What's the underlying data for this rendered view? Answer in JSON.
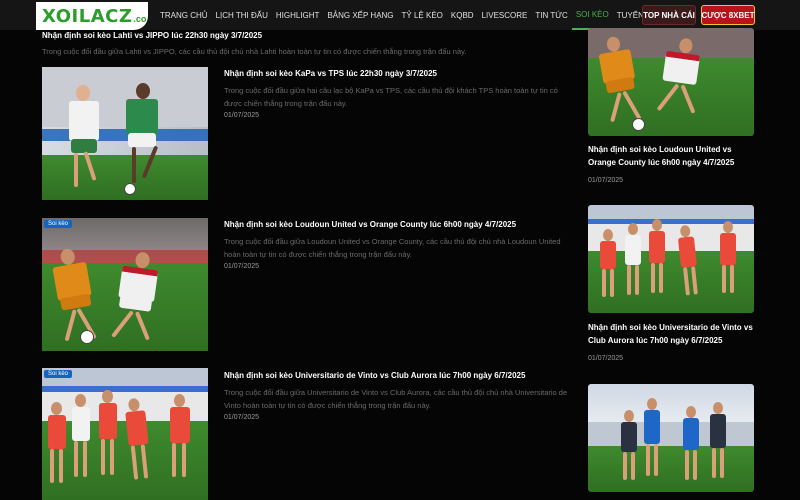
{
  "header": {
    "logo_text": "XOILACZ",
    "logo_suffix": ".co",
    "nav": [
      "TRANG CHỦ",
      "LỊCH THI ĐẤU",
      "HIGHLIGHT",
      "BẢNG XẾP HẠNG",
      "TỶ LỆ KÈO",
      "KQBD",
      "LIVESCORE",
      "TIN TỨC",
      "SOI KÈO",
      "TUYỂN DỤNG"
    ],
    "active_nav": "SOI KÈO",
    "btn_top": "TOP NHÀ CÁI",
    "btn_bet": "CƯỢC 8XBET"
  },
  "feed": {
    "top_title": "Nhận định soi kèo Lahti vs JIPPO lúc 22h30 ngày 3/7/2025",
    "top_desc": "Trong cuộc đối đầu giữa Lahti vs JIPPO, các cầu thủ đội chủ nhà Lahti hoàn toàn tự tin có được chiến thắng trong trận đấu này.",
    "badge": "Soi kèo",
    "articles": [
      {
        "title": "Nhận định soi kèo KaPa vs TPS lúc 22h30 ngày 3/7/2025",
        "desc": "Trong cuộc đối đầu giữa hai câu lạc bộ KaPa vs TPS, các cầu thủ đội khách TPS hoàn toàn tự tin có được chiến thắng trong trận đấu này.",
        "date": "01/07/2025"
      },
      {
        "title": "Nhận định soi kèo Loudoun United vs Orange County lúc 6h00 ngày 4/7/2025",
        "desc": "Trong cuộc đối đầu giữa Loudoun United vs Orange County, các cầu thủ đội chủ nhà Loudoun United hoàn toàn tự tin có được chiến thắng trong trận đấu này.",
        "date": "01/07/2025"
      },
      {
        "title": "Nhận định soi kèo Universitario de Vinto vs Club Aurora lúc 7h00 ngày 6/7/2025",
        "desc": "Trong cuộc đối đầu giữa Universitario de Vinto vs Club Aurora, các cầu thủ đội chủ nhà Universitario de Vinto hoàn toàn tự tin có được chiến thắng trong trận đấu này.",
        "date": "01/07/2025"
      }
    ]
  },
  "sidebar": {
    "items": [
      {
        "title": "Nhận định soi kèo Loudoun United vs Orange County lúc 6h00 ngày 4/7/2025",
        "date": "01/07/2025"
      },
      {
        "title": "Nhận định soi kèo Universitario de Vinto vs Club Aurora lúc 7h00 ngày 6/7/2025",
        "date": "01/07/2025"
      }
    ]
  },
  "colors": {
    "accent": "#4caf50",
    "badge": "#1565c0",
    "bet_button": "#b8121b"
  }
}
